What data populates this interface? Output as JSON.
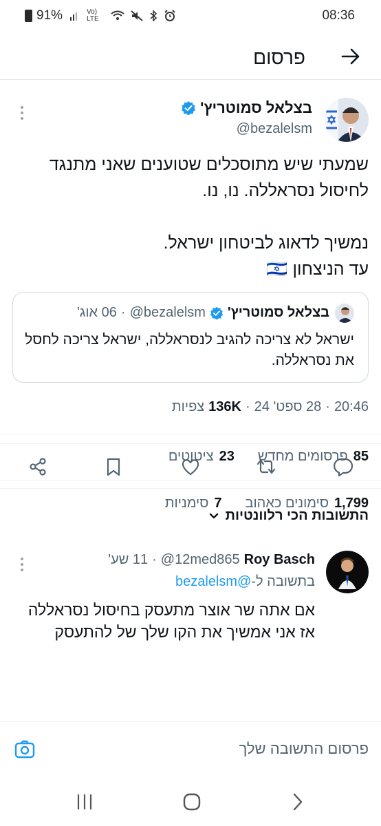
{
  "status_bar": {
    "battery": "91%",
    "time": "08:36",
    "signal_text": "Vo) LTE",
    "icons": [
      "battery-icon",
      "signal-icon",
      "volte-icon",
      "wifi-icon",
      "mute-icon",
      "bluetooth-icon",
      "alarm-icon"
    ]
  },
  "header": {
    "title": "פרסום",
    "back_icon": "arrow-icon"
  },
  "post": {
    "author_name": "בצלאל סמוטריץ'",
    "handle": "@bezalelsm",
    "text_lines": [
      "שמעתי שיש מתוסכלים שטוענים שאני מתנגד",
      "לחיסול נסראללה. נו, נו.",
      "",
      "נמשיך לדאוג לביטחון ישראל.",
      "עד הניצחון 🇮🇱"
    ],
    "quote": {
      "author_name": "בצלאל סמוטריץ'",
      "handle": "@bezalelsm",
      "separator": "·",
      "date": "06 אוג'",
      "text": "ישראל לא צריכה להגיב לנסראללה, ישראל צריכה לחסל את נסראללה."
    },
    "meta": {
      "time": "20:46",
      "separator": "·",
      "date": "28 ספט' 24",
      "views_count": "136K",
      "views_label": "צפיות"
    },
    "stats": {
      "reposts_count": "85",
      "reposts_label": "פרסומים מחדש",
      "quotes_count": "23",
      "quotes_label": "ציטוטים",
      "likes_count": "1,799",
      "likes_label": "סימונים כאהוב",
      "bookmarks_count": "7",
      "bookmarks_label": "סימניות"
    }
  },
  "replies_sort": {
    "label": "התשובות הכי רלוונטיות"
  },
  "reply": {
    "author_name": "Roy Basch",
    "handle": "@12med865",
    "separator": "·",
    "time": "11 שע'",
    "reply_to_label": "בתשובה ל-",
    "reply_to_handle": "@bezalelsm",
    "text_lines": [
      "אם אתה שר אוצר מתעסק בחיסול נסראללה",
      "אז אני אמשיך את הקו שלך של להתעסק"
    ]
  },
  "composer": {
    "placeholder": "פרסום התשובה שלך"
  },
  "colors": {
    "accent": "#1d9bf0",
    "muted_text": "#536471",
    "primary_text": "#0f1419",
    "border": "#cfd9de"
  }
}
